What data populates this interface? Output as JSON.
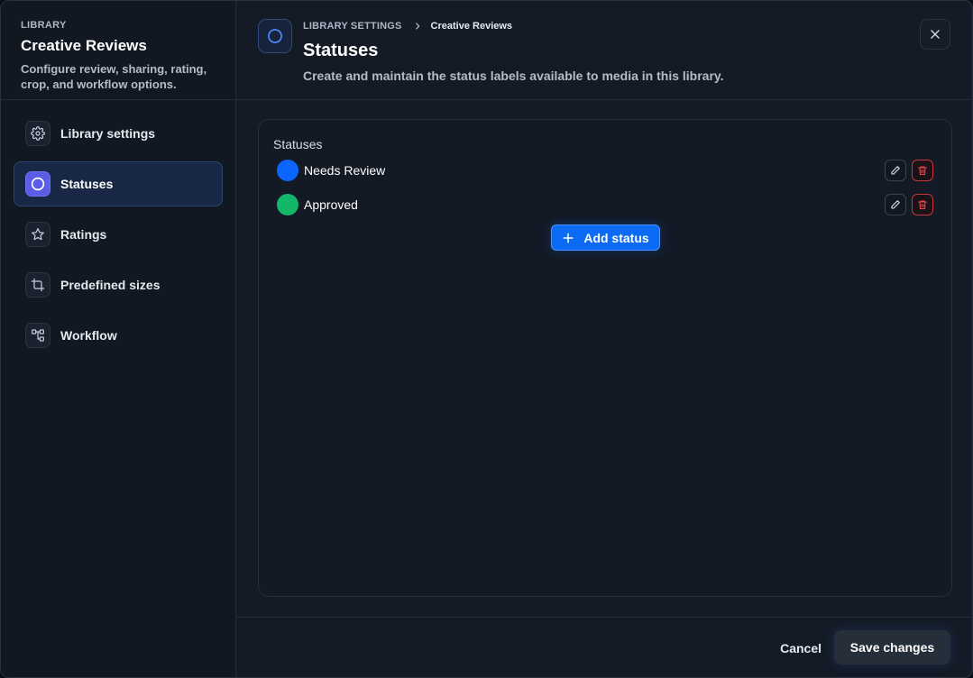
{
  "sidebar": {
    "eyebrow": "LIBRARY",
    "title": "Creative Reviews",
    "description": "Configure review, sharing, rating, crop, and workflow options.",
    "items": [
      {
        "label": "Library settings",
        "icon": "gear-icon",
        "active": false
      },
      {
        "label": "Statuses",
        "icon": "circle-icon",
        "active": true
      },
      {
        "label": "Ratings",
        "icon": "star-icon",
        "active": false
      },
      {
        "label": "Predefined sizes",
        "icon": "crop-icon",
        "active": false
      },
      {
        "label": "Workflow",
        "icon": "workflow-icon",
        "active": false
      }
    ]
  },
  "header": {
    "breadcrumb": [
      "LIBRARY SETTINGS",
      "Creative Reviews"
    ],
    "title": "Statuses",
    "subtitle": "Create and maintain the status labels available to media in this library."
  },
  "panel": {
    "title": "Statuses",
    "statuses": [
      {
        "name": "Needs Review",
        "color": "#0a66ff"
      },
      {
        "name": "Approved",
        "color": "#12b76a"
      }
    ],
    "add_label": "Add status"
  },
  "footer": {
    "cancel_label": "Cancel",
    "save_label": "Save changes"
  },
  "colors": {
    "accent": "#0b6bf5",
    "danger": "#c8353d",
    "active_icon": "#5b5ce8"
  }
}
